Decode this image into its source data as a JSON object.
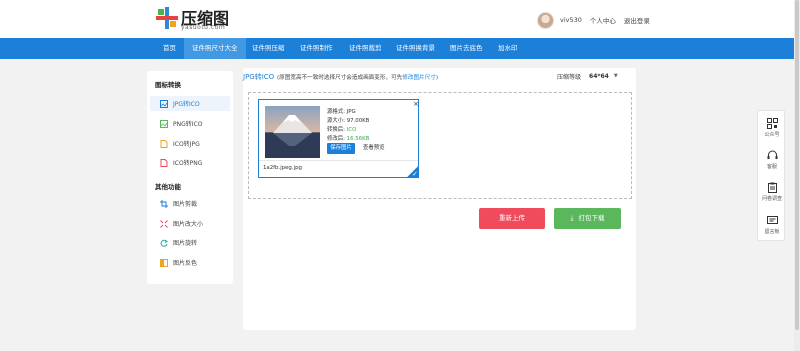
{
  "header": {
    "logo_text": "压缩图",
    "logo_sub": "yasuotu.com",
    "username": "viv530",
    "profile_link": "个人中心",
    "logout_link": "退出登录"
  },
  "nav": [
    {
      "label": "首页"
    },
    {
      "label": "证件照尺寸大全"
    },
    {
      "label": "证件照压缩"
    },
    {
      "label": "证件照制作"
    },
    {
      "label": "证件照裁剪"
    },
    {
      "label": "证件照换背景"
    },
    {
      "label": "图片去底色"
    },
    {
      "label": "加水印"
    }
  ],
  "sidebar": {
    "section1_title": "图标转换",
    "section1_items": [
      {
        "label": "JPG转ICO",
        "icon": "image-icon"
      },
      {
        "label": "PNG转ICO",
        "icon": "image-icon"
      },
      {
        "label": "ICO转JPG",
        "icon": "file-icon"
      },
      {
        "label": "ICO转PNG",
        "icon": "file-icon"
      }
    ],
    "section2_title": "其他功能",
    "section2_items": [
      {
        "label": "图片剪裁",
        "icon": "crop-icon"
      },
      {
        "label": "图片改大小",
        "icon": "resize-icon"
      },
      {
        "label": "图片旋转",
        "icon": "rotate-icon"
      },
      {
        "label": "图片反色",
        "icon": "invert-icon"
      }
    ]
  },
  "main": {
    "title": "JPG转ICO",
    "note_prefix": "(原图宽高不一致时选择尺寸会造成画面变形，可先",
    "note_link": "修改图片尺寸",
    "note_suffix": ")",
    "level_label": "压缩等级",
    "level_value": "64*64"
  },
  "card": {
    "format_label": "源格式:",
    "format_value": "JPG",
    "size_label": "源大小:",
    "size_value": "97.00KB",
    "target_label": "转换后:",
    "target_value": "ICO",
    "new_size_label": "修改后:",
    "new_size_value": "16.56KB",
    "save_button": "保存图片",
    "preview_link": "查看预览",
    "close": "×",
    "filename": "1a2fb.jpeg.jpg"
  },
  "actions": {
    "reupload": "重新上传",
    "download": "打包下载"
  },
  "right_float": [
    {
      "label": "公众号",
      "icon": "qrcode-icon"
    },
    {
      "label": "客服",
      "icon": "headset-icon"
    },
    {
      "label": "问卷调查",
      "icon": "clipboard-icon"
    },
    {
      "label": "留言板",
      "icon": "message-icon"
    }
  ],
  "colors": {
    "nav_blue": "#1c7fd8",
    "reupload_red": "#f04a5d",
    "download_green": "#5bb75b"
  }
}
